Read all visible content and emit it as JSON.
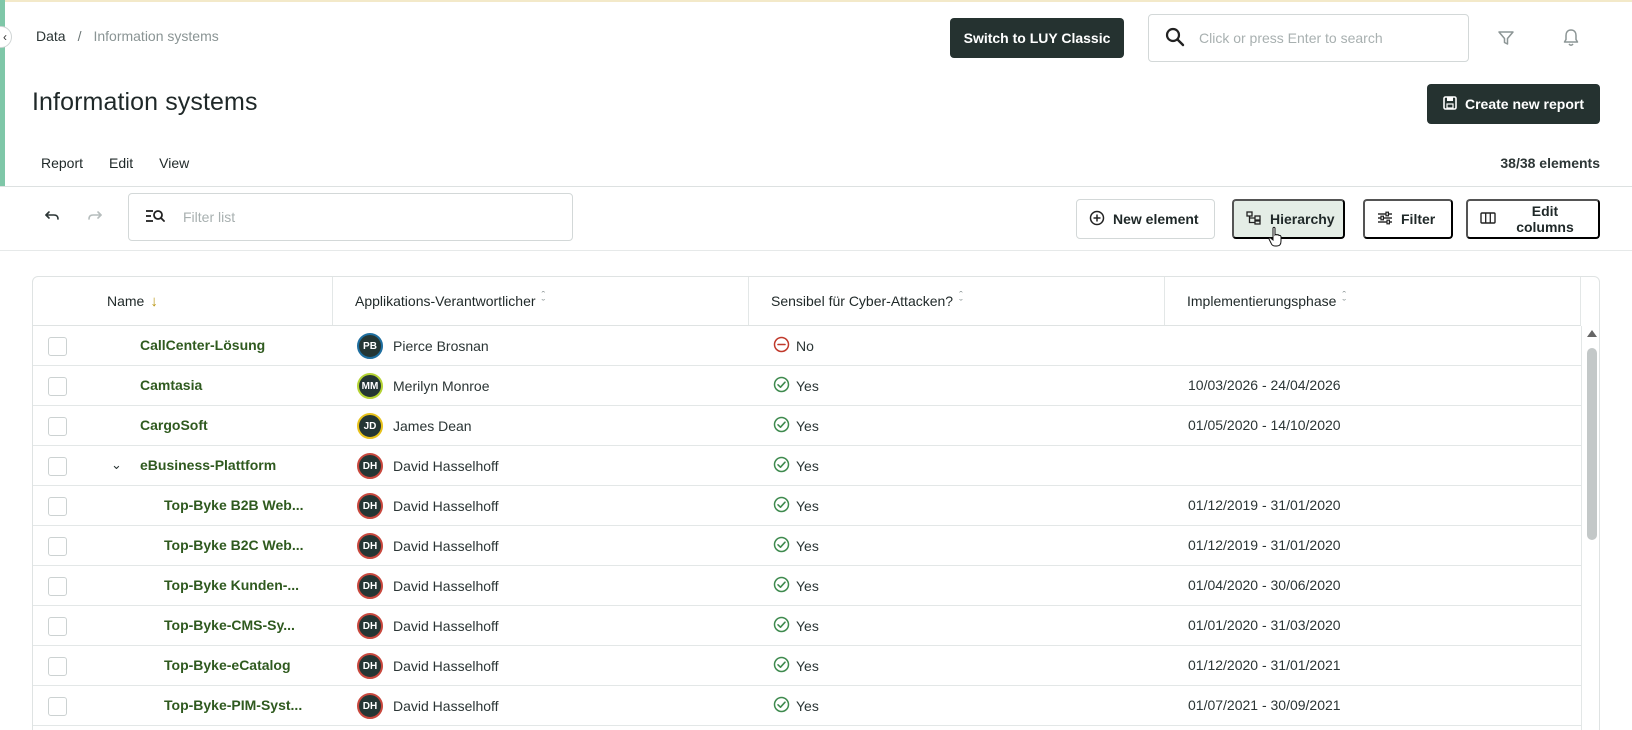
{
  "breadcrumb": {
    "root": "Data",
    "separator": "/",
    "current": "Information systems"
  },
  "header": {
    "switch_label": "Switch to LUY Classic",
    "search_placeholder": "Click or press Enter to search"
  },
  "page": {
    "title": "Information systems",
    "create_report_label": "Create new report",
    "menu": [
      "Report",
      "Edit",
      "View"
    ],
    "element_count": "38/38 elements"
  },
  "toolbar": {
    "filter_placeholder": "Filter list",
    "new_element_label": "New element",
    "hierarchy_label": "Hierarchy",
    "filter_label": "Filter",
    "edit_columns_label": "Edit columns"
  },
  "table": {
    "columns": [
      "Name",
      "Applikations-Verantwortlicher",
      "Sensibel für Cyber-Attacken?",
      "Implementierungsphase"
    ],
    "rows": [
      {
        "name": "CallCenter-Lösung",
        "level": 0,
        "expandable": false,
        "initials": "PB",
        "owner": "Pierce Brosnan",
        "ring": "#1f6fa0",
        "cyber": "No",
        "cyber_status": "no",
        "impl": ""
      },
      {
        "name": "Camtasia",
        "level": 0,
        "expandable": false,
        "initials": "MM",
        "owner": "Merilyn Monroe",
        "ring": "#b5d334",
        "cyber": "Yes",
        "cyber_status": "yes",
        "impl": "10/03/2026 - 24/04/2026"
      },
      {
        "name": "CargoSoft",
        "level": 0,
        "expandable": false,
        "initials": "JD",
        "owner": "James Dean",
        "ring": "#e8c21c",
        "cyber": "Yes",
        "cyber_status": "yes",
        "impl": "01/05/2020 - 14/10/2020"
      },
      {
        "name": "eBusiness-Plattform",
        "level": 0,
        "expandable": true,
        "initials": "DH",
        "owner": "David Hasselhoff",
        "ring": "#c9483e",
        "cyber": "Yes",
        "cyber_status": "yes",
        "impl": ""
      },
      {
        "name": "Top-Byke B2B Web...",
        "level": 1,
        "expandable": false,
        "initials": "DH",
        "owner": "David Hasselhoff",
        "ring": "#c9483e",
        "cyber": "Yes",
        "cyber_status": "yes",
        "impl": "01/12/2019 - 31/01/2020"
      },
      {
        "name": "Top-Byke B2C Web...",
        "level": 1,
        "expandable": false,
        "initials": "DH",
        "owner": "David Hasselhoff",
        "ring": "#c9483e",
        "cyber": "Yes",
        "cyber_status": "yes",
        "impl": "01/12/2019 - 31/01/2020"
      },
      {
        "name": "Top-Byke Kunden-...",
        "level": 1,
        "expandable": false,
        "initials": "DH",
        "owner": "David Hasselhoff",
        "ring": "#c9483e",
        "cyber": "Yes",
        "cyber_status": "yes",
        "impl": "01/04/2020 - 30/06/2020"
      },
      {
        "name": "Top-Byke-CMS-Sy...",
        "level": 1,
        "expandable": false,
        "initials": "DH",
        "owner": "David Hasselhoff",
        "ring": "#c9483e",
        "cyber": "Yes",
        "cyber_status": "yes",
        "impl": "01/01/2020 - 31/03/2020"
      },
      {
        "name": "Top-Byke-eCatalog",
        "level": 1,
        "expandable": false,
        "initials": "DH",
        "owner": "David Hasselhoff",
        "ring": "#c9483e",
        "cyber": "Yes",
        "cyber_status": "yes",
        "impl": "01/12/2020 - 31/01/2021"
      },
      {
        "name": "Top-Byke-PIM-Syst...",
        "level": 1,
        "expandable": false,
        "initials": "DH",
        "owner": "David Hasselhoff",
        "ring": "#c9483e",
        "cyber": "Yes",
        "cyber_status": "yes",
        "impl": "01/07/2021 - 30/09/2021"
      }
    ]
  },
  "colors": {
    "brand_dark": "#253230",
    "name_green": "#2f5a1f",
    "yes_green": "#3e8a4e",
    "no_red": "#c0392b",
    "accent": "#7fc7a8"
  },
  "icons": [
    "search-icon",
    "filter-icon",
    "bell-icon",
    "save-icon",
    "undo-icon",
    "redo-icon",
    "filter-list-icon",
    "plus-circle-icon",
    "hierarchy-icon",
    "sliders-icon",
    "columns-icon",
    "check-circle-icon",
    "minus-circle-icon"
  ]
}
